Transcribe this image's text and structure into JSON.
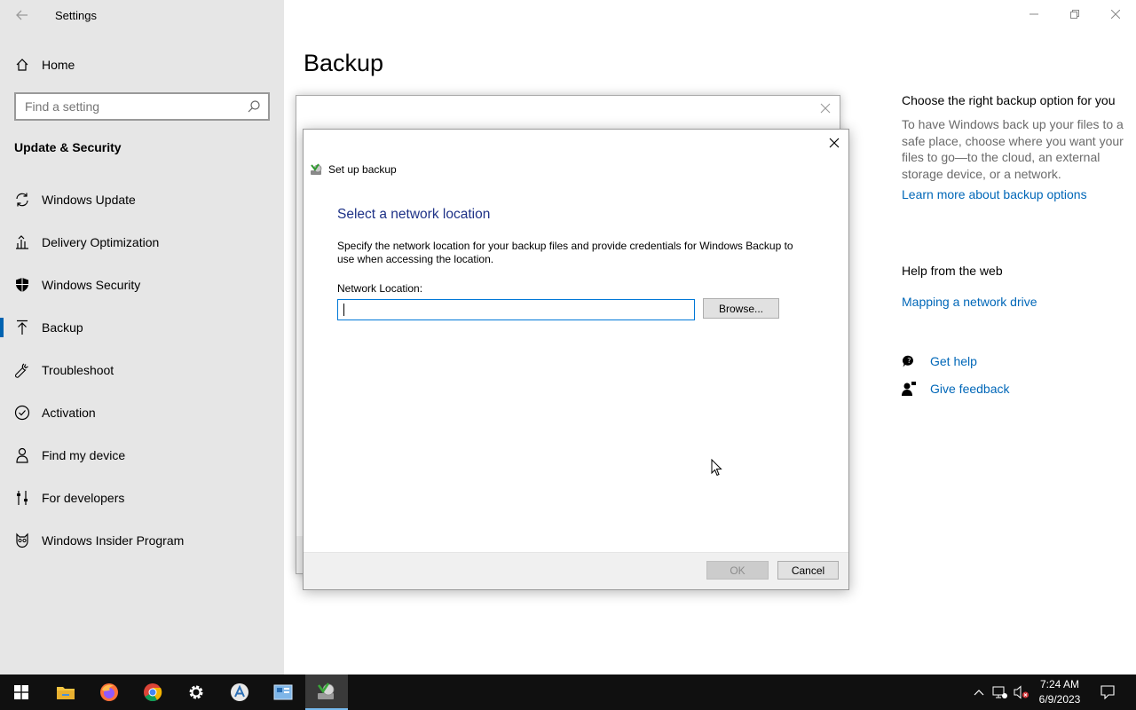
{
  "window": {
    "title": "Settings"
  },
  "sidebar": {
    "home_label": "Home",
    "search_placeholder": "Find a setting",
    "section_heading": "Update & Security",
    "items": [
      {
        "label": "Windows Update",
        "icon": "sync-icon"
      },
      {
        "label": "Delivery Optimization",
        "icon": "delivery-optimization-icon"
      },
      {
        "label": "Windows Security",
        "icon": "shield-icon"
      },
      {
        "label": "Backup",
        "icon": "backup-arrow-icon",
        "active": true
      },
      {
        "label": "Troubleshoot",
        "icon": "wrench-icon"
      },
      {
        "label": "Activation",
        "icon": "check-circle-icon"
      },
      {
        "label": "Find my device",
        "icon": "person-pin-icon"
      },
      {
        "label": "For developers",
        "icon": "developer-sliders-icon"
      },
      {
        "label": "Windows Insider Program",
        "icon": "insider-cat-icon"
      }
    ]
  },
  "main": {
    "page_title": "Backup"
  },
  "info": {
    "heading": "Choose the right backup option for you",
    "text": "To have Windows back up your files to a safe place, choose where you want your files to go—to the cloud, an external storage device, or a network.",
    "link": "Learn more about backup options",
    "web_heading": "Help from the web",
    "web_link": "Mapping a network drive",
    "get_help": "Get help",
    "give_feedback": "Give feedback"
  },
  "dialog": {
    "header": "Set up backup",
    "title": "Select a network location",
    "description": "Specify the network location for your backup files and provide credentials for Windows Backup to use when accessing the location.",
    "location_label": "Network Location:",
    "location_value": "",
    "browse_label": "Browse...",
    "ok_label": "OK",
    "cancel_label": "Cancel"
  },
  "taskbar": {
    "apps": [
      "file-explorer-icon",
      "firefox-icon",
      "chrome-icon",
      "settings-gear-icon",
      "app-store-icon",
      "control-panel-icon",
      "backup-app-icon"
    ],
    "time": "7:24 AM",
    "date": "6/9/2023"
  },
  "colors": {
    "accent": "#0067b8",
    "dialog_title": "#1e3287",
    "sidebar_bg": "#e6e6e6",
    "taskbar_bg": "#101010"
  }
}
